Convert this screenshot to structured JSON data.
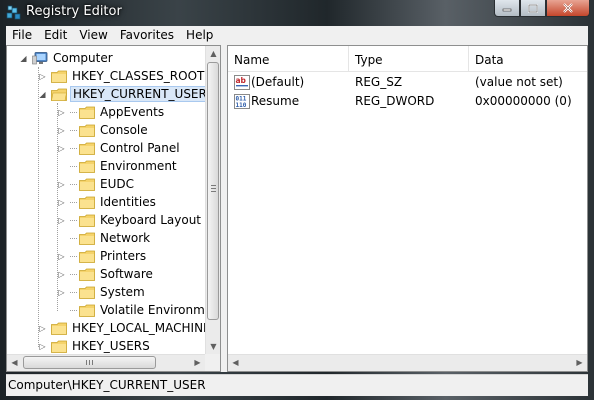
{
  "window": {
    "title": "Registry Editor"
  },
  "menu": {
    "items": [
      "File",
      "Edit",
      "View",
      "Favorites",
      "Help"
    ]
  },
  "tree": {
    "root": "Computer",
    "hives": {
      "classes_root": "HKEY_CLASSES_ROOT",
      "current_user": "HKEY_CURRENT_USER",
      "local_machine": "HKEY_LOCAL_MACHINE",
      "users": "HKEY_USERS"
    },
    "subkeys": [
      "AppEvents",
      "Console",
      "Control Panel",
      "Environment",
      "EUDC",
      "Identities",
      "Keyboard Layout",
      "Network",
      "Printers",
      "Software",
      "System",
      "Volatile Environment"
    ]
  },
  "list": {
    "columns": {
      "name": "Name",
      "type": "Type",
      "data": "Data"
    },
    "rows": [
      {
        "name": "(Default)",
        "type": "REG_SZ",
        "data": "(value not set)",
        "icon": "string-value-icon"
      },
      {
        "name": "Resume",
        "type": "REG_DWORD",
        "data": "0x00000000 (0)",
        "icon": "binary-value-icon"
      }
    ]
  },
  "status": {
    "path": "Computer\\HKEY_CURRENT_USER"
  }
}
